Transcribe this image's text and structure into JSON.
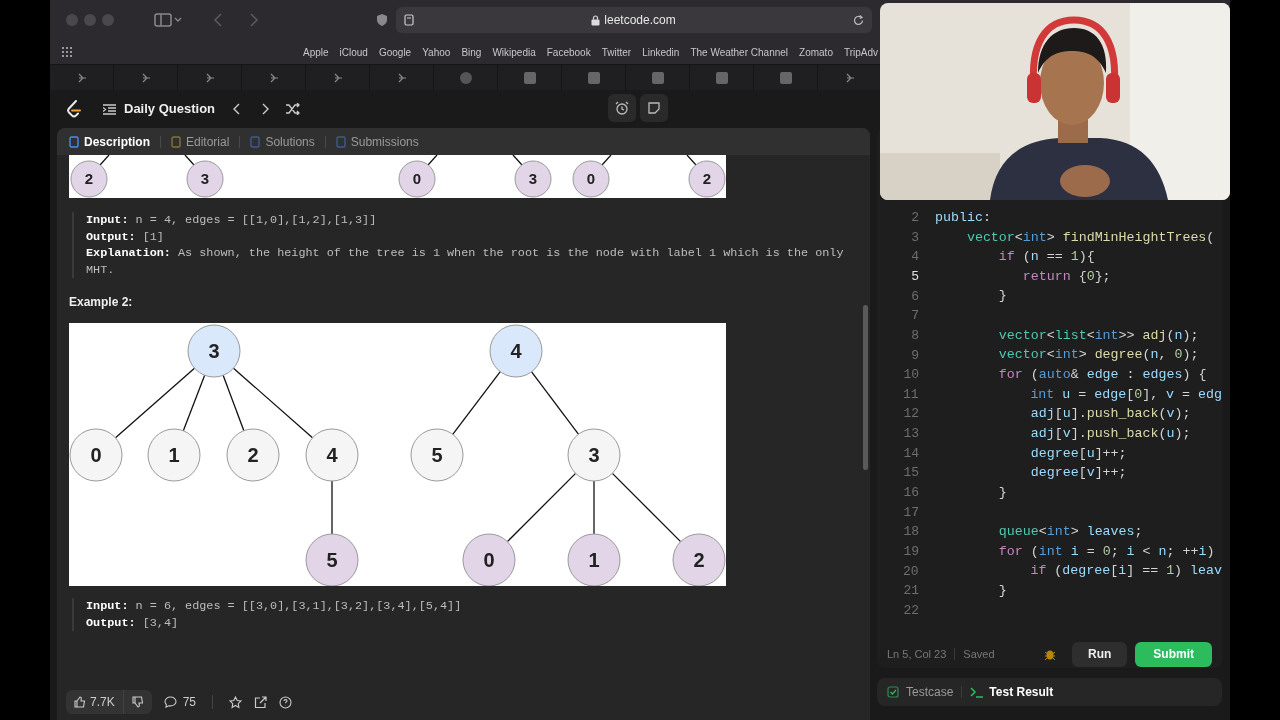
{
  "browser": {
    "address": "leetcode.com",
    "bookmarks": [
      "Apple",
      "iCloud",
      "Google",
      "Yahoo",
      "Bing",
      "Wikipedia",
      "Facebook",
      "Twitter",
      "Linkedin",
      "The Weather Channel",
      "Zomato",
      "TripAdv"
    ]
  },
  "header": {
    "title": "Daily Question"
  },
  "tabs": [
    {
      "label": "Description",
      "selected": true
    },
    {
      "label": "Editorial",
      "selected": false
    },
    {
      "label": "Solutions",
      "selected": false
    },
    {
      "label": "Submissions",
      "selected": false
    }
  ],
  "example1": {
    "nodes": [
      {
        "label": "2",
        "color": "#e1d5e7"
      },
      {
        "label": "3",
        "color": "#e1d5e7"
      },
      {
        "label": "0",
        "color": "#e1d5e7"
      },
      {
        "label": "3",
        "color": "#e1d5e7"
      },
      {
        "label": "0",
        "color": "#e1d5e7"
      },
      {
        "label": "2",
        "color": "#e1d5e7"
      }
    ],
    "lines": [
      {
        "label": "Input:",
        "value": "n = 4, edges = [[1,0],[1,2],[1,3]]"
      },
      {
        "label": "Output:",
        "value": "[1]"
      },
      {
        "label": "Explanation:",
        "value": "As shown, the height of the tree is 1 when the root is the node with label 1 which is the only MHT."
      }
    ]
  },
  "example2": {
    "title": "Example 2:",
    "nodes": [
      {
        "label": "3",
        "color": "#dae8fc"
      },
      {
        "label": "0",
        "color": "#f5f5f5"
      },
      {
        "label": "1",
        "color": "#f5f5f5"
      },
      {
        "label": "2",
        "color": "#f5f5f5"
      },
      {
        "label": "4",
        "color": "#f5f5f5"
      },
      {
        "label": "5",
        "color": "#e1d5e7"
      },
      {
        "label": "4",
        "color": "#dae8fc"
      },
      {
        "label": "5",
        "color": "#f5f5f5"
      },
      {
        "label": "3",
        "color": "#f5f5f5"
      },
      {
        "label": "0",
        "color": "#e1d5e7"
      },
      {
        "label": "1",
        "color": "#e1d5e7"
      },
      {
        "label": "2",
        "color": "#e1d5e7"
      }
    ],
    "lines": [
      {
        "label": "Input:",
        "value": "n = 6, edges = [[3,0],[3,1],[3,2],[3,4],[5,4]]"
      },
      {
        "label": "Output:",
        "value": "[3,4]"
      }
    ]
  },
  "footer": {
    "likes": "7.7K",
    "comments": "75"
  },
  "editor": {
    "lines": [
      {
        "number": "2",
        "text": "public:",
        "current": false
      },
      {
        "number": "3",
        "text": "    vector<int> findMinHeightTrees(",
        "current": false
      },
      {
        "number": "4",
        "text": "        if (n == 1){",
        "current": false
      },
      {
        "number": "5",
        "text": "           return {0};",
        "current": true
      },
      {
        "number": "6",
        "text": "        }",
        "current": false
      },
      {
        "number": "7",
        "current": false
      },
      {
        "number": "8",
        "text": "        vector<list<int>> adj(n);",
        "current": false
      },
      {
        "number": "9",
        "text": "        vector<int> degree(n, 0);",
        "current": false
      },
      {
        "number": "10",
        "text": "        for (auto& edge : edges) {",
        "current": false
      },
      {
        "number": "11",
        "text": "            int u = edge[0], v = edg",
        "current": false
      },
      {
        "number": "12",
        "text": "            adj[u].push_back(v);",
        "current": false
      },
      {
        "number": "13",
        "text": "            adj[v].push_back(u);",
        "current": false
      },
      {
        "number": "14",
        "text": "            degree[u]++;",
        "current": false
      },
      {
        "number": "15",
        "text": "            degree[v]++;",
        "current": false
      },
      {
        "number": "16",
        "text": "        }",
        "current": false
      },
      {
        "number": "17",
        "current": false
      },
      {
        "number": "18",
        "text": "        queue<int> leaves;",
        "current": false
      },
      {
        "number": "19",
        "text": "        for (int i = 0; i < n; ++i)",
        "current": false
      },
      {
        "number": "20",
        "text": "            if (degree[i] == 1) leav",
        "current": false
      },
      {
        "number": "21",
        "text": "        }",
        "current": false
      },
      {
        "number": "22",
        "current": false
      }
    ],
    "position": "Ln 5, Col 23",
    "save_state": "Saved",
    "run": "Run",
    "submit": "Submit"
  },
  "console_tabs": [
    {
      "label": "Testcase",
      "selected": false
    },
    {
      "label": "Test Result",
      "selected": true
    }
  ]
}
